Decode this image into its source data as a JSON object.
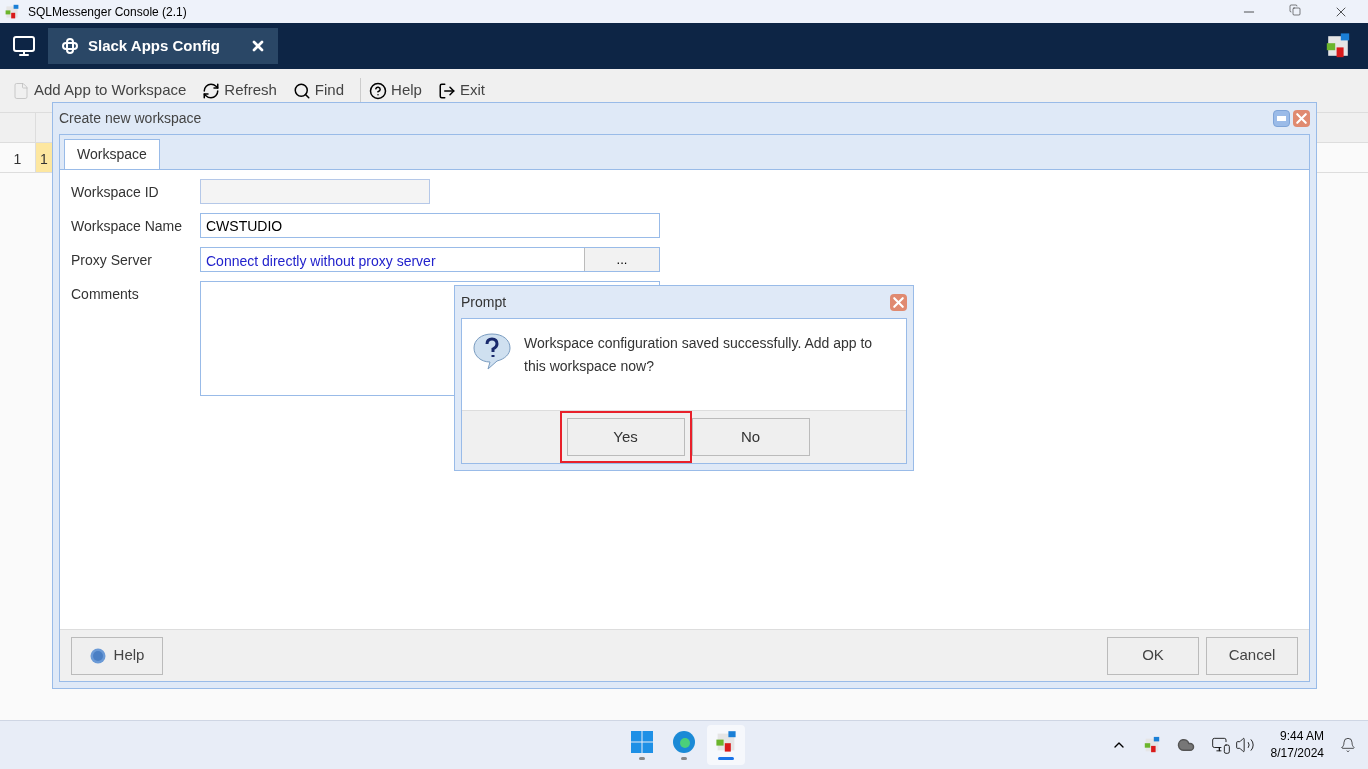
{
  "window": {
    "title": "SQLMessenger Console (2.1)"
  },
  "tabs": [
    {
      "label": "Slack Apps Config",
      "selected": true
    }
  ],
  "toolbar": [
    "Add App to Workspace",
    "Refresh",
    "Find",
    "Help",
    "Exit"
  ],
  "grid": {
    "rows": [
      {
        "number": "1",
        "cells": [
          "1"
        ],
        "selected": true
      }
    ]
  },
  "dialog": {
    "title": "Create new workspace",
    "tabs": [
      {
        "label": "Workspace",
        "selected": true
      }
    ],
    "fields": [
      {
        "kind": "text",
        "label": "Workspace ID",
        "disabled": true
      },
      {
        "kind": "text",
        "label": "Workspace Name",
        "value": "CWSTUDIO",
        "disabled": false
      },
      {
        "kind": "picker",
        "label": "Proxy Server",
        "value": "Connect directly without proxy server",
        "button": "..."
      },
      {
        "kind": "textarea",
        "label": "Comments"
      }
    ],
    "help": "Help",
    "buttons": [
      "OK",
      "Cancel"
    ]
  },
  "prompt": {
    "title": "Prompt",
    "message": "Workspace configuration saved successfully. Add app to this workspace now?",
    "buttons": [
      {
        "label": "Yes",
        "highlighted": true
      },
      {
        "label": "No",
        "highlighted": false
      }
    ]
  },
  "taskbar": {
    "apps": [
      {
        "selected": false
      },
      {
        "selected": false
      },
      {
        "selected": true
      }
    ],
    "time": "9:44 AM",
    "date": "8/17/2024"
  }
}
